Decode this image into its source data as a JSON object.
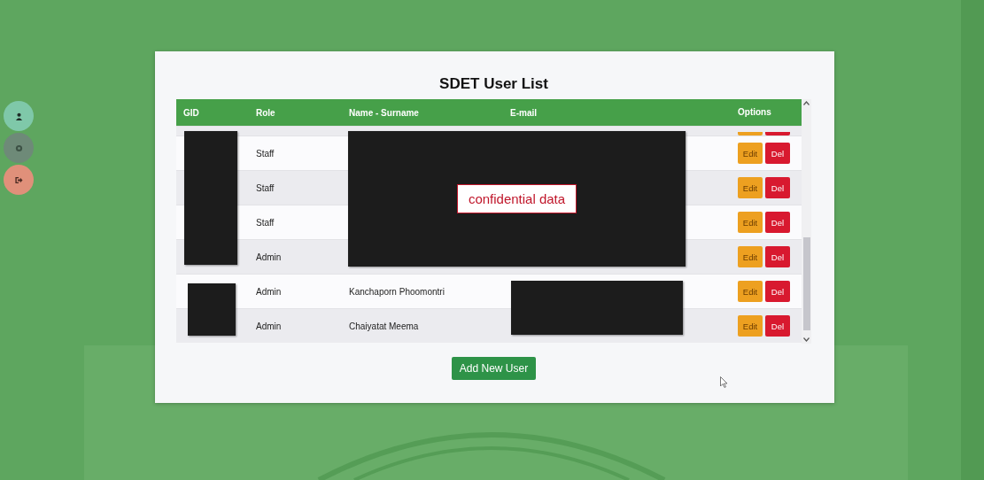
{
  "sidebar": {
    "buttons": [
      {
        "kind": "user",
        "color": "#7fc8a9"
      },
      {
        "kind": "settings",
        "color": "#6e8a78"
      },
      {
        "kind": "logout",
        "color": "#e0907a"
      }
    ]
  },
  "card": {
    "title": "SDET User List",
    "table": {
      "columns": [
        "GID",
        "Role",
        "Name - Surname",
        "E-mail",
        "Options"
      ],
      "partial_row_above": true,
      "rows": [
        {
          "role": "Staff",
          "name": "",
          "edit": "Edit",
          "delete": "Del"
        },
        {
          "role": "Staff",
          "name": "",
          "edit": "Edit",
          "delete": "Del"
        },
        {
          "role": "Staff",
          "name": "",
          "edit": "Edit",
          "delete": "Del"
        },
        {
          "role": "Admin",
          "name": "",
          "edit": "Edit",
          "delete": "Del"
        },
        {
          "role": "Admin",
          "name": "Kanchaporn Phoomontri",
          "edit": "Edit",
          "delete": "Del"
        },
        {
          "role": "Admin",
          "name": "Chaiyatat Meema",
          "edit": "Edit",
          "delete": "Del"
        }
      ]
    },
    "redaction_label": "confidential data",
    "add_button": "Add New User"
  }
}
